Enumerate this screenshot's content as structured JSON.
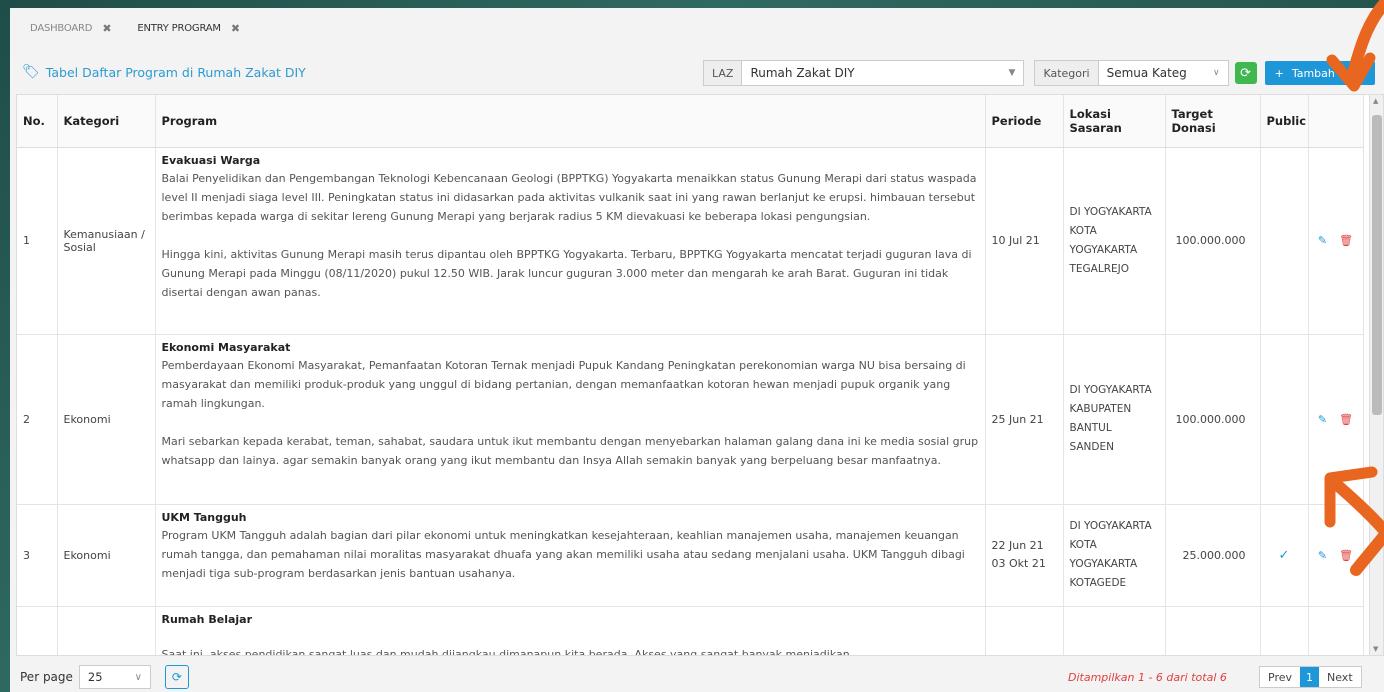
{
  "tabs": [
    {
      "label": "DASHBOARD",
      "close": "✖"
    },
    {
      "label": "ENTRY PROGRAM",
      "close": "✖"
    }
  ],
  "title": "Tabel Daftar Program di Rumah Zakat DIY",
  "filters": {
    "laz_label": "LAZ",
    "laz_value": "Rumah Zakat DIY",
    "kategori_label": "Kategori",
    "kategori_value": "Semua Kateg"
  },
  "add_button": "Tambah Data",
  "columns": [
    "No.",
    "Kategori",
    "Program",
    "Periode",
    "Lokasi Sasaran",
    "Target Donasi",
    "Public",
    ""
  ],
  "rows": [
    {
      "no": "1",
      "kategori": "Kemanusiaan / Sosial",
      "title": "Evakuasi Warga",
      "desc1": "Balai Penyelidikan dan Pengembangan Teknologi Kebencanaan Geologi (BPPTKG) Yogyakarta menaikkan status Gunung Merapi dari status waspada level II menjadi siaga level III. Peningkatan status ini didasarkan pada aktivitas vulkanik saat ini yang rawan berlanjut ke erupsi. himbauan tersebut berimbas kepada warga di sekitar lereng Gunung Merapi yang berjarak radius 5 KM dievakuasi ke beberapa lokasi pengungsian.",
      "desc2": "Hingga kini, aktivitas Gunung Merapi masih terus dipantau oleh BPPTKG Yogyakarta. Terbaru, BPPTKG Yogyakarta mencatat terjadi guguran lava di Gunung Merapi pada Minggu (08/11/2020) pukul 12.50 WIB. Jarak luncur guguran 3.000 meter dan mengarah ke arah Barat. Guguran ini tidak disertai dengan awan panas.",
      "periode": "10 Jul 21",
      "lokasi": "DI YOGYAKARTA KOTA YOGYAKARTA TEGALREJO",
      "target": "100.000.000",
      "public": ""
    },
    {
      "no": "2",
      "kategori": "Ekonomi",
      "title": "Ekonomi Masyarakat",
      "desc1": "Pemberdayaan Ekonomi Masyarakat, Pemanfaatan Kotoran Ternak menjadi Pupuk Kandang Peningkatan perekonomian warga NU bisa bersaing di masyarakat dan memiliki produk-produk yang unggul di bidang pertanian, dengan memanfaatkan kotoran hewan menjadi pupuk organik yang ramah lingkungan.",
      "desc2": "Mari sebarkan kepada kerabat, teman, sahabat, saudara untuk ikut membantu dengan menyebarkan halaman galang dana ini ke media sosial grup whatsapp dan lainya. agar semakin banyak orang yang ikut membantu dan Insya Allah semakin banyak yang berpeluang besar manfaatnya.",
      "periode": "25 Jun 21",
      "lokasi": "DI YOGYAKARTA KABUPATEN BANTUL SANDEN",
      "target": "100.000.000",
      "public": ""
    },
    {
      "no": "3",
      "kategori": "Ekonomi",
      "title": "UKM Tangguh",
      "desc1": "Program UKM Tangguh adalah bagian dari pilar ekonomi untuk meningkatkan kesejahteraan, keahlian manajemen usaha, manajemen keuangan rumah tangga, dan pemahaman nilai moralitas masyarakat dhuafa yang akan memiliki usaha atau sedang menjalani usaha. UKM Tangguh dibagi menjadi tiga sub-program berdasarkan jenis bantuan usahanya.",
      "desc2": "",
      "periode": "22 Jun 21 03 Okt 21",
      "lokasi": "DI YOGYAKARTA KOTA YOGYAKARTA KOTAGEDE",
      "target": "25.000.000",
      "public": "✓"
    },
    {
      "no": "",
      "kategori": "",
      "title": "Rumah Belajar",
      "desc1": "Saat ini, akses pendidikan sangat luas dan mudah dijangkau dimanapun kita berada. Akses yang sangat banyak menjadikan",
      "desc2": "",
      "periode": "",
      "lokasi": "",
      "target": "",
      "public": ""
    }
  ],
  "footer": {
    "per_page_label": "Per page",
    "per_page_value": "25",
    "info": "Ditampilkan 1 - 6 dari total 6",
    "prev": "Prev",
    "page": "1",
    "next": "Next"
  },
  "colors": {
    "accent": "#1e97d8",
    "refresh": "#3fb850",
    "danger": "#e04040",
    "arrow": "#e8661f"
  },
  "icons": [
    "tag-icon",
    "refresh-icon",
    "plus-icon",
    "pencil-icon",
    "trash-icon",
    "check-circle-icon"
  ]
}
